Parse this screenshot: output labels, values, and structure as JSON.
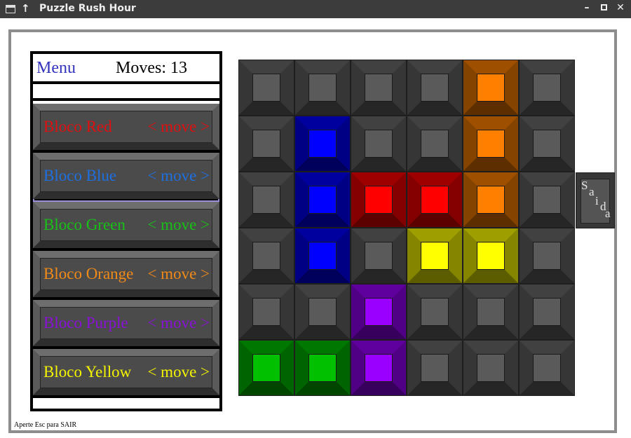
{
  "window": {
    "title": "Puzzle Rush Hour"
  },
  "panel": {
    "menu_label": "Menu",
    "moves_label": "Moves:",
    "moves_value": "13",
    "move_label": "< move >",
    "selected_index": 1,
    "blocks": [
      {
        "label": "Bloco Red",
        "color": "#e01010"
      },
      {
        "label": "Bloco Blue",
        "color": "#1e6fe0"
      },
      {
        "label": "Bloco Green",
        "color": "#18c018"
      },
      {
        "label": "Bloco Orange",
        "color": "#f08a18"
      },
      {
        "label": "Bloco Purple",
        "color": "#8a10d8"
      },
      {
        "label": "Bloco Yellow",
        "color": "#f4f400"
      }
    ]
  },
  "footer_hint": "Aperte Esc para SAIR",
  "board": {
    "rows": 6,
    "cols": 6,
    "exit_label": "Saida",
    "empty_color": "#5a5a5a",
    "pieces": [
      {
        "name": "orange",
        "color": "#ff8000",
        "cells": [
          [
            0,
            4
          ],
          [
            1,
            4
          ],
          [
            2,
            4
          ]
        ]
      },
      {
        "name": "blue",
        "color": "#0000ff",
        "cells": [
          [
            1,
            1
          ],
          [
            2,
            1
          ],
          [
            3,
            1
          ]
        ]
      },
      {
        "name": "red",
        "color": "#ff0000",
        "cells": [
          [
            2,
            2
          ],
          [
            2,
            3
          ]
        ]
      },
      {
        "name": "yellow",
        "color": "#ffff00",
        "cells": [
          [
            3,
            3
          ],
          [
            3,
            4
          ]
        ]
      },
      {
        "name": "purple",
        "color": "#9900ff",
        "cells": [
          [
            4,
            2
          ],
          [
            5,
            2
          ]
        ]
      },
      {
        "name": "green",
        "color": "#00c000",
        "cells": [
          [
            5,
            0
          ],
          [
            5,
            1
          ]
        ]
      }
    ]
  }
}
